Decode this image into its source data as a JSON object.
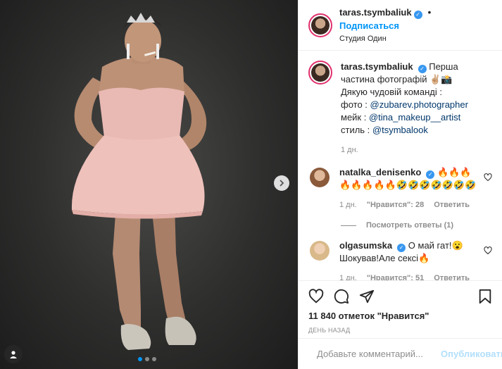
{
  "header": {
    "username": "taras.tsymbaliuk",
    "separator": "•",
    "follow_label": "Подписаться",
    "location": "Студия Один"
  },
  "caption": {
    "username": "taras.tsymbaliuk",
    "line1": "Перша частина фотографій ✌🏼📸",
    "line2": "Дякую чудовій команді :",
    "photo_prefix": "фото : ",
    "photo_tag": "@zubarev.photographer",
    "makeup_prefix": "мейк : ",
    "makeup_tag": "@tina_makeup__artist",
    "style_prefix": "стиль : ",
    "style_tag": "@tsymbalook",
    "time": "1 дн."
  },
  "comments": [
    {
      "username": "natalka_denisenko",
      "text": "🔥🔥🔥🔥🔥🔥🔥🔥🤣🤣🤣🤣🤣🤣🤣",
      "time": "1 дн.",
      "likes": "\"Нравится\": 28",
      "reply": "Ответить",
      "view_replies": "Посмотреть ответы (1)"
    },
    {
      "username": "olgasumska",
      "text": "О май гат!😮 Шокував!Але сексі🔥",
      "time": "1 дн.",
      "likes": "\"Нравится\": 51",
      "reply": "Ответить"
    }
  ],
  "actions": {
    "likes_count": "11 840 отметок \"Нравится\"",
    "date": "ДЕНЬ НАЗАД"
  },
  "add_comment": {
    "placeholder": "Добавьте комментарий...",
    "post_label": "Опубликовать"
  },
  "carousel": {
    "slides": 3,
    "active": 1
  },
  "colors": {
    "accent": "#0095f6",
    "verified": "#3897f0",
    "tag": "#00376b"
  }
}
